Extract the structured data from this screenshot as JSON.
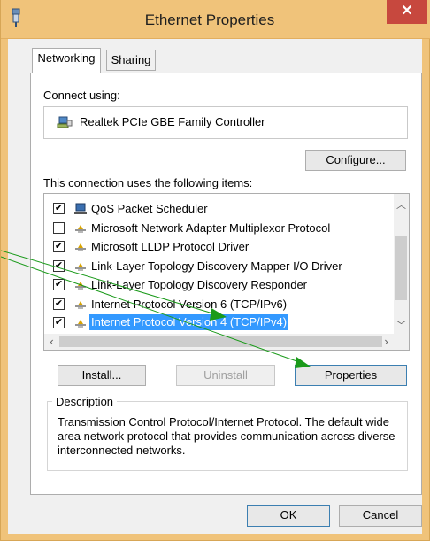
{
  "window": {
    "title": "Ethernet Properties",
    "close_glyph": "✕"
  },
  "tabs": [
    {
      "label": "Networking",
      "active": true
    },
    {
      "label": "Sharing",
      "active": false
    }
  ],
  "networking": {
    "connect_using_label": "Connect using:",
    "adapter_name": "Realtek PCIe GBE Family Controller",
    "configure_button": "Configure...",
    "items_label": "This connection uses the following items:",
    "items": [
      {
        "label": "QoS Packet Scheduler",
        "checked": true,
        "icon": "computer-network-icon",
        "selected": false
      },
      {
        "label": "Microsoft Network Adapter Multiplexor Protocol",
        "checked": false,
        "icon": "protocol-icon",
        "selected": false
      },
      {
        "label": "Microsoft LLDP Protocol Driver",
        "checked": true,
        "icon": "protocol-icon",
        "selected": false
      },
      {
        "label": "Link-Layer Topology Discovery Mapper I/O Driver",
        "checked": true,
        "icon": "protocol-icon",
        "selected": false
      },
      {
        "label": "Link-Layer Topology Discovery Responder",
        "checked": true,
        "icon": "protocol-icon",
        "selected": false
      },
      {
        "label": "Internet Protocol Version 6 (TCP/IPv6)",
        "checked": true,
        "icon": "protocol-icon",
        "selected": false
      },
      {
        "label": "Internet Protocol Version 4 (TCP/IPv4)",
        "checked": true,
        "icon": "protocol-icon",
        "selected": true
      }
    ],
    "install_button": "Install...",
    "uninstall_button": "Uninstall",
    "properties_button": "Properties",
    "description_legend": "Description",
    "description_text": "Transmission Control Protocol/Internet Protocol. The default wide area network protocol that provides communication across diverse interconnected networks."
  },
  "footer": {
    "ok_button": "OK",
    "cancel_button": "Cancel"
  },
  "colors": {
    "title_bar": "#f0c37a",
    "close_button": "#c7483e",
    "selection": "#3399ff",
    "annotation_arrow": "#1a9a1a"
  }
}
